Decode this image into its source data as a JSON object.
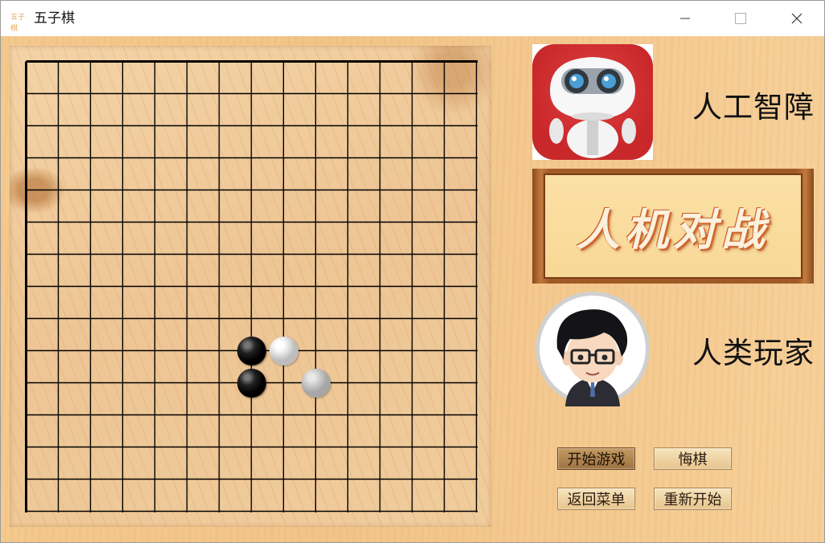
{
  "window": {
    "title": "五子棋",
    "icon_text": "五子棋"
  },
  "players": {
    "ai_label": "人工智障",
    "human_label": "人类玩家"
  },
  "banner": {
    "text": "人机对战"
  },
  "buttons": {
    "start": "开始游戏",
    "undo": "悔棋",
    "menu": "返回菜单",
    "restart": "重新开始"
  },
  "board": {
    "size": 15,
    "stones": [
      {
        "col": 7,
        "row": 9,
        "color": "black"
      },
      {
        "col": 8,
        "row": 9,
        "color": "white"
      },
      {
        "col": 7,
        "row": 10,
        "color": "black"
      },
      {
        "col": 9,
        "row": 10,
        "color": "white",
        "last_move": true
      }
    ]
  },
  "colors": {
    "background": "#f2c488",
    "board": "#eec594",
    "grid_line": "#000000",
    "ai_tile": "#c8282a",
    "banner_frame": "#a05a25",
    "banner_text_outline": "#d1642a"
  }
}
